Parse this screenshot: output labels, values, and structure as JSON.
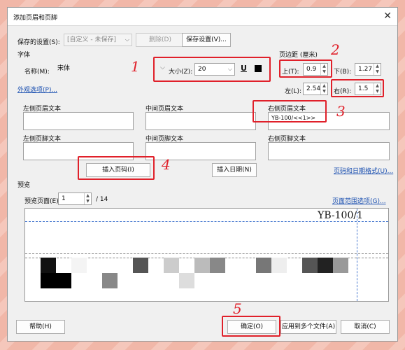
{
  "window": {
    "title": "添加页眉和页脚",
    "close_glyph": "✕"
  },
  "top": {
    "saved_settings_label": "保存的设置(S):",
    "saved_settings_value": "[自定义 - 未保存]",
    "delete_button": "删除(D)",
    "save_settings_button": "保存设置(V)..."
  },
  "font": {
    "group_title": "字体",
    "name_label": "名称(M):",
    "name_value": "宋体",
    "size_label": "大小(Z):",
    "size_value": "20",
    "underline_glyph": "U",
    "appearance_link": "外观选项(P)..."
  },
  "margins": {
    "group_title": "页边距 (厘米)",
    "top_label": "上(T):",
    "top_value": "0.9",
    "bottom_label": "下(B):",
    "bottom_value": "1.27",
    "left_label": "左(L):",
    "left_value": "2.54",
    "right_label": "右(R):",
    "right_value": "1.5"
  },
  "header_footer": {
    "left_header": "左侧页眉文本",
    "center_header": "中间页眉文本",
    "right_header": "右侧页眉文本",
    "right_header_value": "YB-100/<<1>>",
    "left_footer": "左侧页脚文本",
    "center_footer": "中间页脚文本",
    "right_footer": "右侧页脚文本",
    "insert_page_button": "插入页码(I)",
    "insert_date_button": "插入日期(N)",
    "page_date_format_link": "页码和日期格式(U)..."
  },
  "preview": {
    "group_title": "预览",
    "page_label": "预览页面(E)",
    "page_value": "1",
    "page_total": "/ 14",
    "page_range_link": "页面范围选项(G)...",
    "header_text": "YB-100/1"
  },
  "bottom": {
    "help_button": "帮助(H)",
    "ok_button": "确定(O)",
    "apply_multi_button": "应用到多个文件(A)",
    "cancel_button": "取消(C)"
  },
  "annotations": [
    "1",
    "2",
    "3",
    "4",
    "5"
  ],
  "colors": {
    "annotation_red": "#e0202a",
    "link_blue": "#1a4fb0",
    "guide_blue": "#4a7bd0"
  }
}
